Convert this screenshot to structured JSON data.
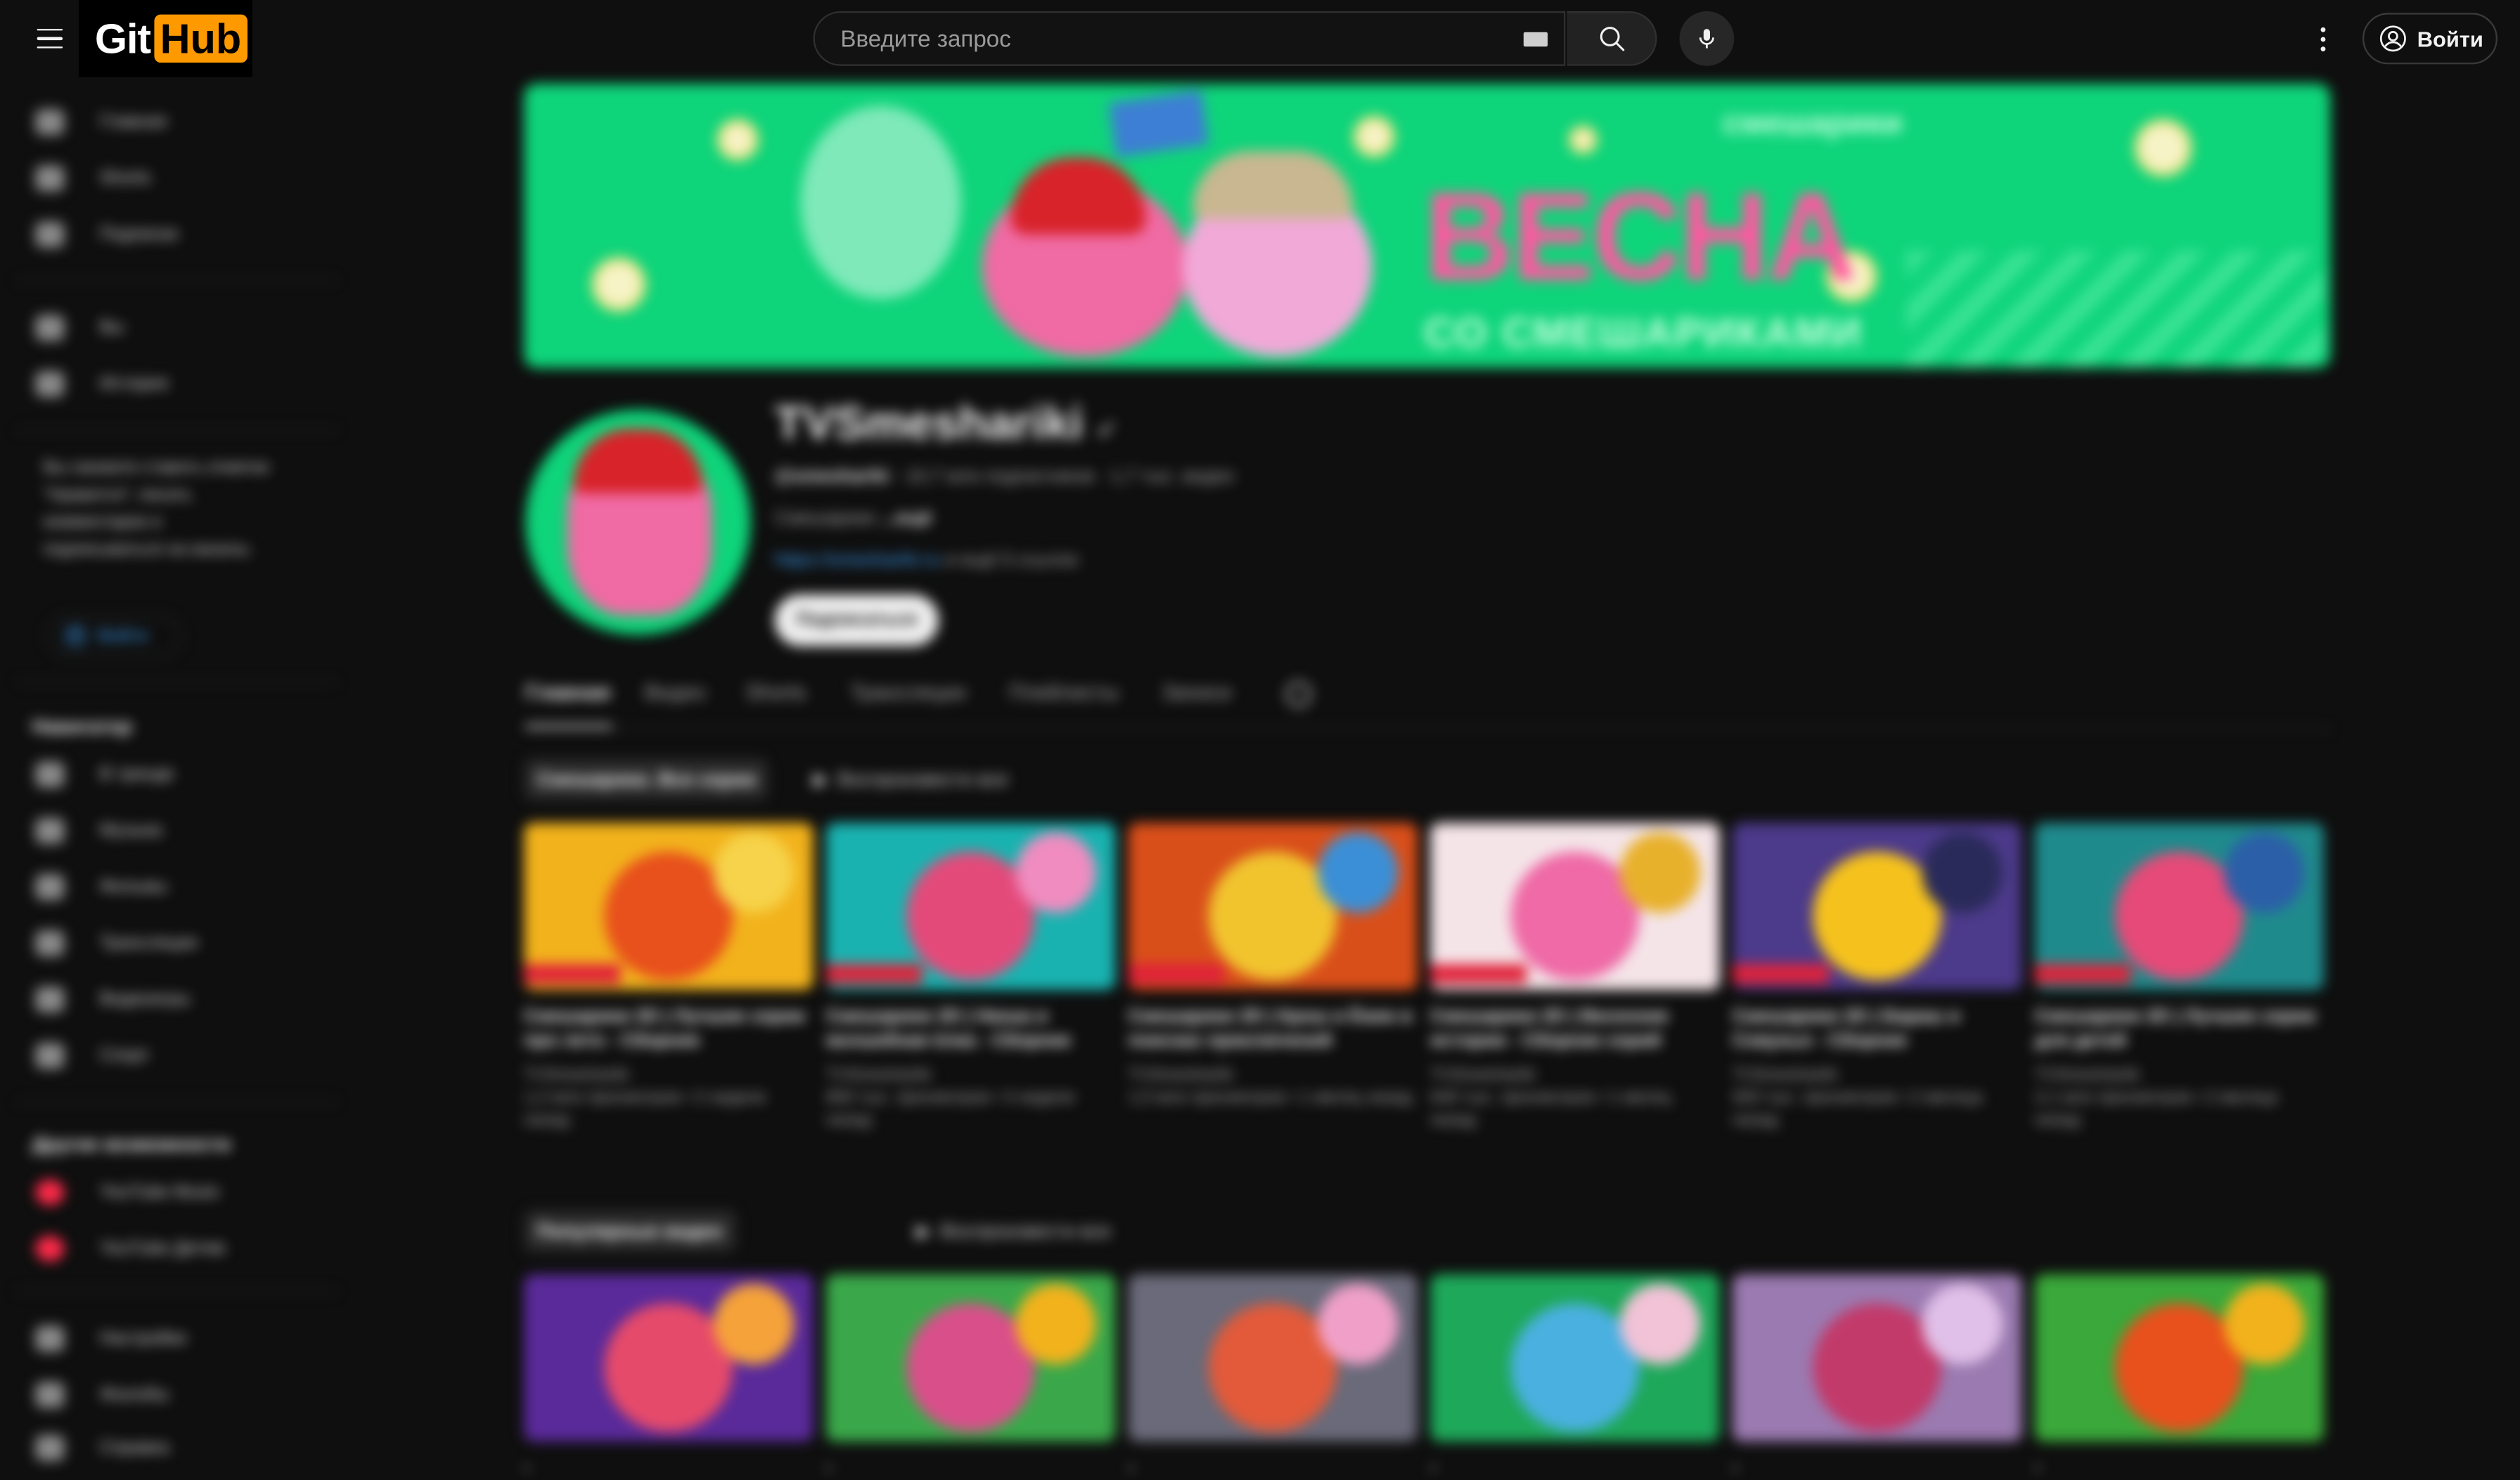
{
  "header": {
    "logo_left": "Git",
    "logo_right": "Hub",
    "logo_sup": "",
    "search_placeholder": "Введите запрос",
    "signin_label": "Войти"
  },
  "sidebar": {
    "items": [
      {
        "label": "Главная"
      },
      {
        "label": "Shorts"
      },
      {
        "label": "Подписки"
      }
    ],
    "you": [
      {
        "label": "Вы"
      },
      {
        "label": "История"
      }
    ],
    "note": "Вы сможете ставить отметки \"Нравится\", писать комментарии и подписываться на каналы.",
    "login_label": "Войти",
    "nav_heading": "Навигатор",
    "nav": [
      {
        "label": "В тренде"
      },
      {
        "label": "Музыка"
      },
      {
        "label": "Фильмы"
      },
      {
        "label": "Трансляции"
      },
      {
        "label": "Видеоигры"
      },
      {
        "label": "Спорт"
      }
    ],
    "more_heading": "Другие возможности",
    "more": [
      {
        "label": "YouTube Music"
      },
      {
        "label": "YouTube Детям"
      }
    ],
    "settings": [
      {
        "label": "Настройки"
      },
      {
        "label": "Жалобы"
      },
      {
        "label": "Справка"
      }
    ]
  },
  "banner": {
    "title": "ВЕСНА",
    "subtitle": "СО СМЕШАРИКАМИ",
    "brand": "смешарики"
  },
  "channel": {
    "name": "TVSmeshariki",
    "handle": "@smeshariki",
    "subscribers": "10,7 млн подписчиков",
    "videos": "1,7 тыс. видео",
    "description": "Смешарики",
    "description_more": "...ещё",
    "link_text": "https://smeshariki.ru",
    "link_more": "и ещё 5 ссылок",
    "subscribe_label": "Подписаться"
  },
  "tabs": [
    "Главная",
    "Видео",
    "Shorts",
    "Трансляции",
    "Плейлисты",
    "Записи"
  ],
  "sections": [
    {
      "title": "Смешарики. Все серии",
      "play_all": "Воспроизвести все",
      "videos": [
        {
          "title": "Смешарики 2D | Лучшие серии про лето - Сборник",
          "channel": "TVSmeshariki",
          "stats": "1,2 млн просмотров",
          "age": "2 недели назад",
          "colors": [
            "#f2b21c",
            "#e8501c",
            "#f6d34a"
          ]
        },
        {
          "title": "Смешарики 2D | Нюша и волшебная ёлка - Сборник",
          "channel": "TVSmeshariki",
          "stats": "850 тыс. просмотров",
          "age": "3 недели назад",
          "colors": [
            "#19b2b0",
            "#e34a7a",
            "#f08cc0"
          ]
        },
        {
          "title": "Смешарики 2D | Крош и Ёжик в поисках приключений",
          "channel": "TVSmeshariki",
          "stats": "1,5 млн просмотров",
          "age": "1 месяц назад",
          "colors": [
            "#d94f1a",
            "#f1c42e",
            "#3b8fd6"
          ]
        },
        {
          "title": "Смешарики 2D | Весенние истории - Сборник серий",
          "channel": "TVSmeshariki",
          "stats": "640 тыс. просмотров",
          "age": "1 месяц назад",
          "colors": [
            "#f4e4e8",
            "#ef6aa6",
            "#e8b12c"
          ]
        },
        {
          "title": "Смешарики 2D | Бараш и Совунья - Сборник",
          "channel": "TVSmeshariki",
          "stats": "920 тыс. просмотров",
          "age": "2 месяца назад",
          "colors": [
            "#4c3a8a",
            "#f5c21d",
            "#2a2a5a"
          ]
        },
        {
          "title": "Смешарики 2D | Лучшие серии для детей",
          "channel": "TVSmeshariki",
          "stats": "2,1 млн просмотров",
          "age": "2 месяца назад",
          "colors": [
            "#1f8a8c",
            "#e64a78",
            "#2b5fa8"
          ]
        }
      ]
    },
    {
      "title": "Популярные видео",
      "play_all": "Воспроизвести все",
      "videos": [
        {
          "title": "",
          "channel": "",
          "stats": "",
          "age": "",
          "colors": [
            "#5a2a9a",
            "#e64a6a",
            "#f5a23a"
          ]
        },
        {
          "title": "",
          "channel": "",
          "stats": "",
          "age": "",
          "colors": [
            "#3aa84a",
            "#d94f8a",
            "#f2b21c"
          ]
        },
        {
          "title": "",
          "channel": "",
          "stats": "",
          "age": "",
          "colors": [
            "#6a6a7a",
            "#e25a3a",
            "#f0a0c8"
          ]
        },
        {
          "title": "",
          "channel": "",
          "stats": "",
          "age": "",
          "colors": [
            "#1ea85a",
            "#4ab0e0",
            "#f2c2d6"
          ]
        },
        {
          "title": "",
          "channel": "",
          "stats": "",
          "age": "",
          "colors": [
            "#9a7ab0",
            "#c23a6a",
            "#e0c0e8"
          ]
        },
        {
          "title": "",
          "channel": "",
          "stats": "",
          "age": "",
          "colors": [
            "#3aa83a",
            "#e8501c",
            "#f2b21c"
          ]
        }
      ]
    }
  ],
  "colors": {
    "background": "#0f0f0f",
    "banner": "#0ed47a",
    "accent": "#ff9900",
    "link": "#3ea6ff"
  }
}
